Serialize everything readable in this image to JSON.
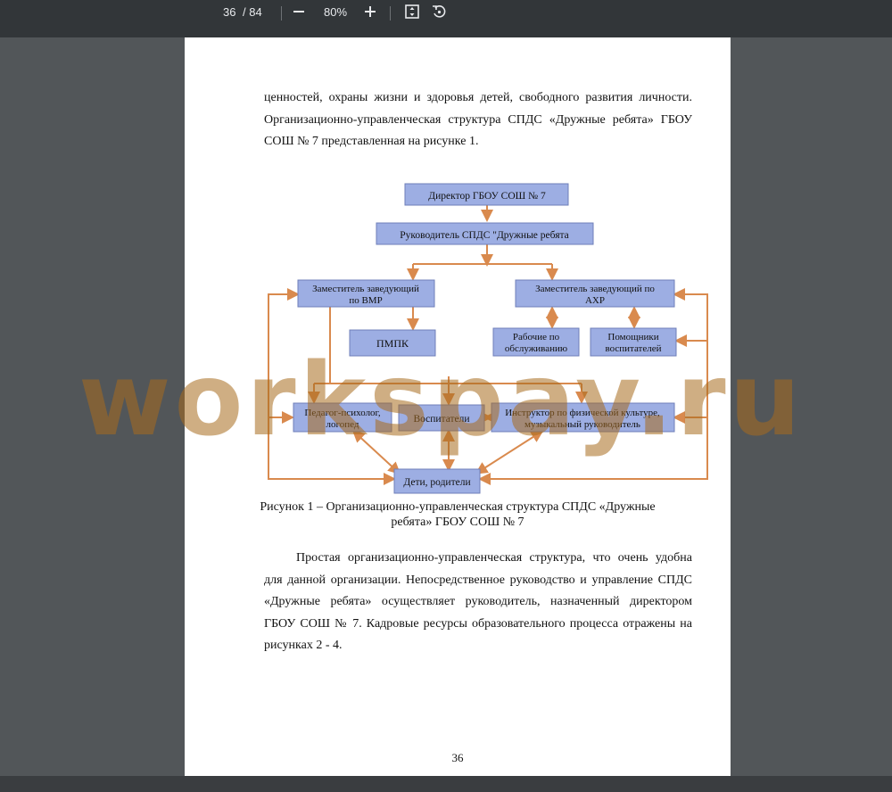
{
  "viewer": {
    "page_current": "36",
    "page_total": "/ 84",
    "zoom": "80%",
    "zoom_out_label": "−",
    "zoom_in_label": "+",
    "icons": [
      "minus-icon",
      "plus-icon",
      "fit-page-icon",
      "rotate-icon"
    ]
  },
  "document": {
    "intro_lines": [
      "ценностей, охраны жизни и здоровья детей, свободного развития личности.",
      "Организационно-управленческая структура СПДС «Дружные ребята» ГБОУ",
      "СОШ № 7 представленная на рисунке 1."
    ],
    "diagram": {
      "director": "Директор ГБОУ СОШ № 7",
      "head": "Руководитель СПДС \"Дружные ребята",
      "deputy_vmr_1": "Заместитель заведующий",
      "deputy_vmr_2": "по ВМР",
      "deputy_ahr_1": "Заместитель заведующий по",
      "deputy_ahr_2": "АХР",
      "pmpk": "ПМПК",
      "workers_1": "Рабочие по",
      "workers_2": "обслуживанию",
      "assistants_1": "Помощники",
      "assistants_2": "воспитателей",
      "psych_1": "Педагог-психолог,",
      "psych_2": "логопед",
      "educators": "Воспитатели",
      "instructor_1": "Инструктор по физической культуре,",
      "instructor_2": "музыкальный руководитель",
      "children": "Дети, родители",
      "colors": {
        "box_fill": "#9daee3",
        "box_border": "#6f7fb8",
        "arrow": "#d98a4e"
      }
    },
    "caption_line1": "Рисунок 1 – Организационно-управленческая структура СПДС «Дружные",
    "caption_line2": "ребята» ГБОУ СОШ № 7",
    "body_lines": [
      "Простая организационно-управленческая структура, что очень удобна",
      "для данной организации. Непосредственное руководство и управление СПДС",
      "«Дружные ребята» осуществляет руководитель, назначенный директором",
      "ГБОУ СОШ № 7. Кадровые ресурсы образовательного процесса отражены на",
      "рисунках 2 - 4."
    ],
    "page_number": "36"
  },
  "watermark": "workspay.ru"
}
